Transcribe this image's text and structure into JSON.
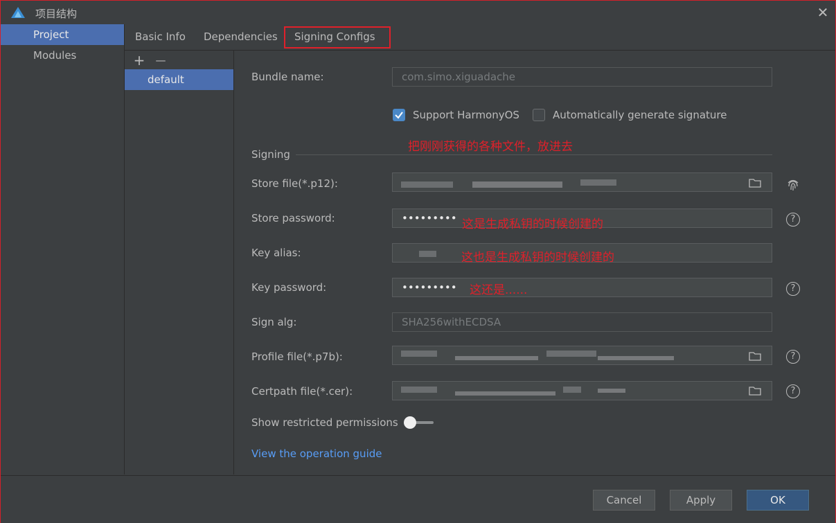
{
  "window": {
    "title": "项目结构",
    "close": "✕"
  },
  "nav": {
    "items": [
      {
        "label": "Project"
      },
      {
        "label": "Modules"
      }
    ]
  },
  "tabs": [
    {
      "label": "Basic Info"
    },
    {
      "label": "Dependencies"
    },
    {
      "label": "Signing Configs"
    }
  ],
  "config_list": {
    "add": "+",
    "remove": "—",
    "items": [
      {
        "label": "default"
      }
    ]
  },
  "form": {
    "bundle_name": {
      "label": "Bundle name:",
      "value": "com.simo.xiguadache"
    },
    "support_harmony": {
      "label": "Support HarmonyOS",
      "checked": true
    },
    "auto_sign": {
      "label": "Automatically generate signature",
      "checked": false
    },
    "signing_section": "Signing",
    "store_file": {
      "label": "Store file(*.p12):"
    },
    "store_password": {
      "label": "Store password:",
      "value": "•••••••••"
    },
    "key_alias": {
      "label": "Key alias:"
    },
    "key_password": {
      "label": "Key password:",
      "value": "•••••••••"
    },
    "sign_alg": {
      "label": "Sign alg:",
      "value": "SHA256withECDSA"
    },
    "profile_file": {
      "label": "Profile file(*.p7b):"
    },
    "certpath_file": {
      "label": "Certpath file(*.cer):"
    },
    "restricted_permissions": {
      "label": "Show restricted permissions",
      "enabled": false
    },
    "guide_link": "View the operation guide"
  },
  "annotations": {
    "files": "把刚刚获得的各种文件，放进去",
    "store_password": "这是生成私钥的时候创建的",
    "key_alias": "这也是生成私钥的时候创建的",
    "key_password": "这还是......"
  },
  "footer": {
    "cancel": "Cancel",
    "apply": "Apply",
    "ok": "OK"
  },
  "colors": {
    "accent": "#4b6eaf",
    "link": "#589df6",
    "annotation": "#e0202a"
  }
}
